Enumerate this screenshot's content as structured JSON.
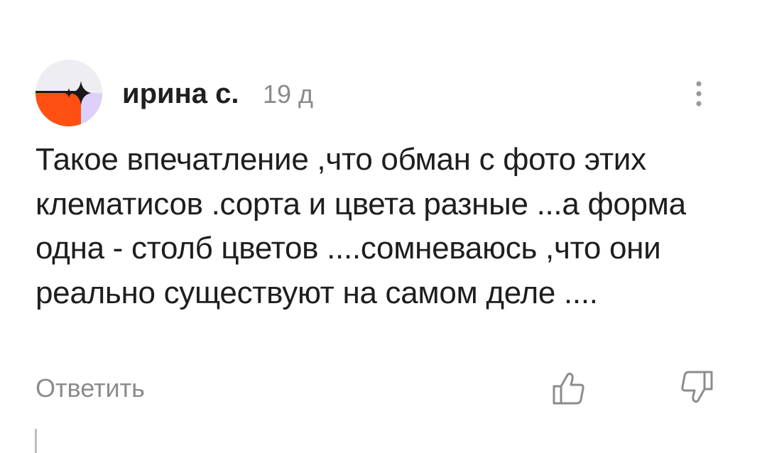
{
  "comment": {
    "author": "ирина с.",
    "time": "19 д",
    "text": "Такое впечатление ,что обман с фото этих клематисов .сорта и цвета разные ...а форма одна - столб цветов ....сомневаюсь ,что они реально существуют на самом деле ....",
    "reply_label": "Ответить"
  },
  "icons": {
    "avatar": "avatar-graphic",
    "more": "more-vertical-icon",
    "like": "thumbs-up-icon",
    "dislike": "thumbs-down-icon"
  },
  "colors": {
    "avatar_top": "#eeeef2",
    "avatar_orange": "#ff4f12",
    "avatar_lavender": "#ddd1fb",
    "star": "#1a1a1a",
    "muted_text": "#8c8c8c",
    "body_text": "#1e1e1e"
  }
}
